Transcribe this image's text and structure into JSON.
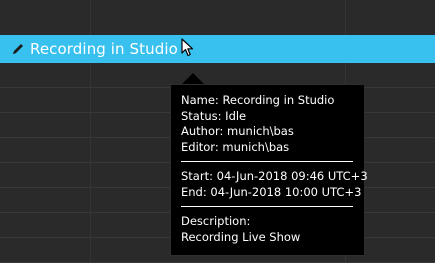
{
  "event": {
    "title": "Recording in Studio",
    "color": "#38c1ef"
  },
  "tooltip": {
    "name_line": "Name: Recording in Studio",
    "status_line": "Status: Idle",
    "author_line": "Author: munich\\bas",
    "editor_line": "Editor: munich\\bas",
    "start_line": "Start: 04-Jun-2018 09:46 UTC+3",
    "end_line": "End: 04-Jun-2018 10:00 UTC+3",
    "description_label": "Description:",
    "description_value": "Recording Live Show"
  },
  "icons": {
    "event_icon": "pencil-icon",
    "cursor": "mouse-cursor"
  }
}
